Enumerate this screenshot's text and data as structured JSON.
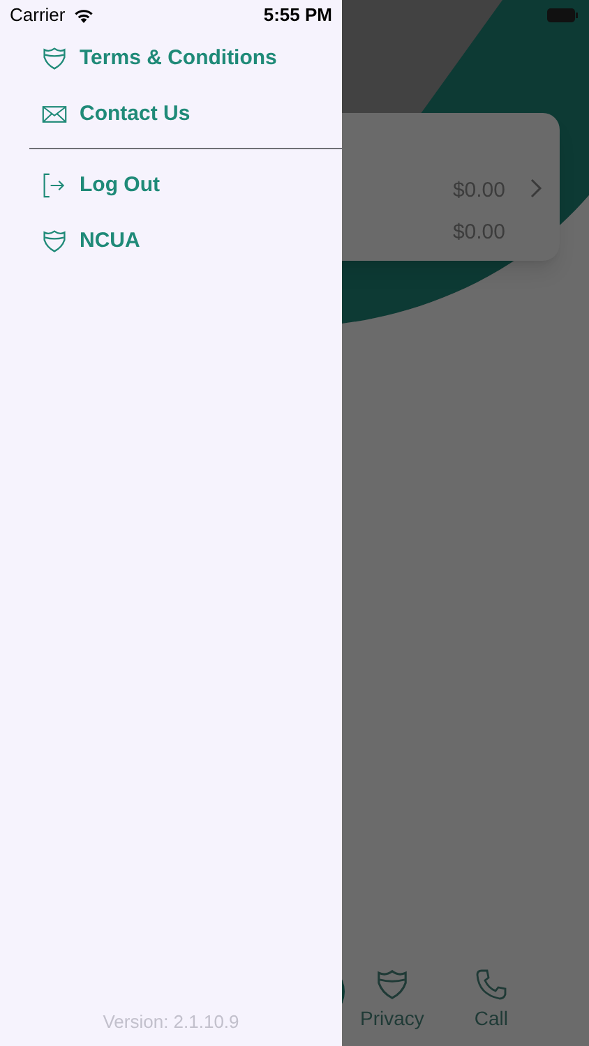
{
  "status_bar": {
    "carrier": "Carrier",
    "time": "5:55 PM"
  },
  "drawer": {
    "sections": [
      [
        {
          "label": "Terms & Conditions",
          "kind": "shield"
        },
        {
          "label": "Contact Us",
          "kind": "mail"
        }
      ],
      [
        {
          "label": "Log Out",
          "kind": "logout"
        },
        {
          "label": "NCUA",
          "kind": "shield"
        }
      ]
    ],
    "version": "Version: 2.1.10.9"
  },
  "account_card": {
    "amounts": [
      "$0.00",
      "$0.00"
    ]
  },
  "tab_bar": [
    {
      "label": "Privacy",
      "kind": "shield"
    },
    {
      "label": "Call",
      "kind": "phone"
    }
  ]
}
